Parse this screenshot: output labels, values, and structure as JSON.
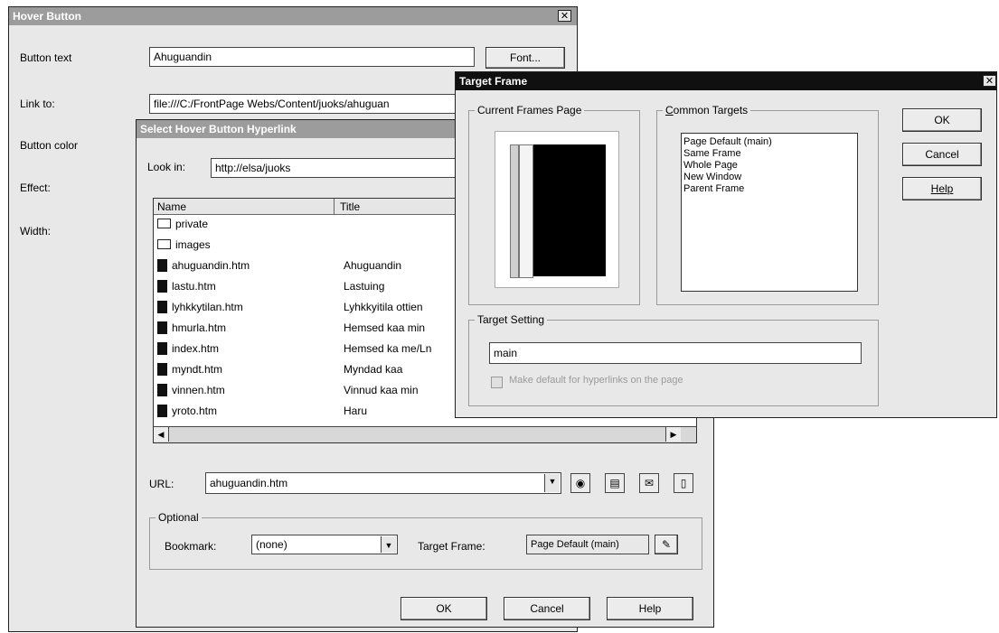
{
  "hover": {
    "title": "Hover Button",
    "labels": {
      "button_text": "Button text",
      "link_to": "Link to:",
      "button_color": "Button color",
      "effect": "Effect:",
      "width": "Width:"
    },
    "button_text_value": "Ahuguandin",
    "link_value": "file:///C:/FrontPage Webs/Content/juoks/ahuguan",
    "font_button": "Font..."
  },
  "select": {
    "title": "Select Hover Button Hyperlink",
    "look_in_label": "Look in:",
    "look_in_value": "http://elsa/juoks",
    "columns": {
      "name": "Name",
      "title": "Title"
    },
    "files": [
      {
        "name": "private",
        "title": "",
        "type": "folder"
      },
      {
        "name": "images",
        "title": "",
        "type": "folder"
      },
      {
        "name": "ahuguandin.htm",
        "title": "Ahuguandin",
        "type": "file"
      },
      {
        "name": "lastu.htm",
        "title": "Lastuing",
        "type": "file"
      },
      {
        "name": "lyhkkytilan.htm",
        "title": "Lyhkkyitila ottien",
        "type": "file"
      },
      {
        "name": "hmurla.htm",
        "title": "Hemsed kaa min",
        "type": "file"
      },
      {
        "name": "index.htm",
        "title": "Hemsed ka me/Ln",
        "type": "file"
      },
      {
        "name": "myndt.htm",
        "title": "Myndad kaa",
        "type": "file"
      },
      {
        "name": "vinnen.htm",
        "title": "Vinnud kaa min",
        "type": "file"
      },
      {
        "name": "yroto.htm",
        "title": "Haru",
        "type": "file"
      }
    ],
    "url_label": "URL:",
    "url_value": "ahuguandin.htm",
    "optional_label": "Optional",
    "bookmark_label": "Bookmark:",
    "bookmark_value": "(none)",
    "target_frame_label": "Target Frame:",
    "target_frame_value": "Page Default (main)",
    "ok": "OK",
    "cancel": "Cancel",
    "help": "Help"
  },
  "target": {
    "title": "Target Frame",
    "current_frames_label": "Current Frames Page",
    "common_targets_label": "Common Targets",
    "targets": [
      "Page Default (main)",
      "Same Frame",
      "Whole Page",
      "New Window",
      "Parent Frame"
    ],
    "ok": "OK",
    "cancel": "Cancel",
    "help": "Help",
    "target_setting_label": "Target Setting",
    "target_setting_value": "main",
    "make_default_label": "Make default for hyperlinks on the page"
  }
}
